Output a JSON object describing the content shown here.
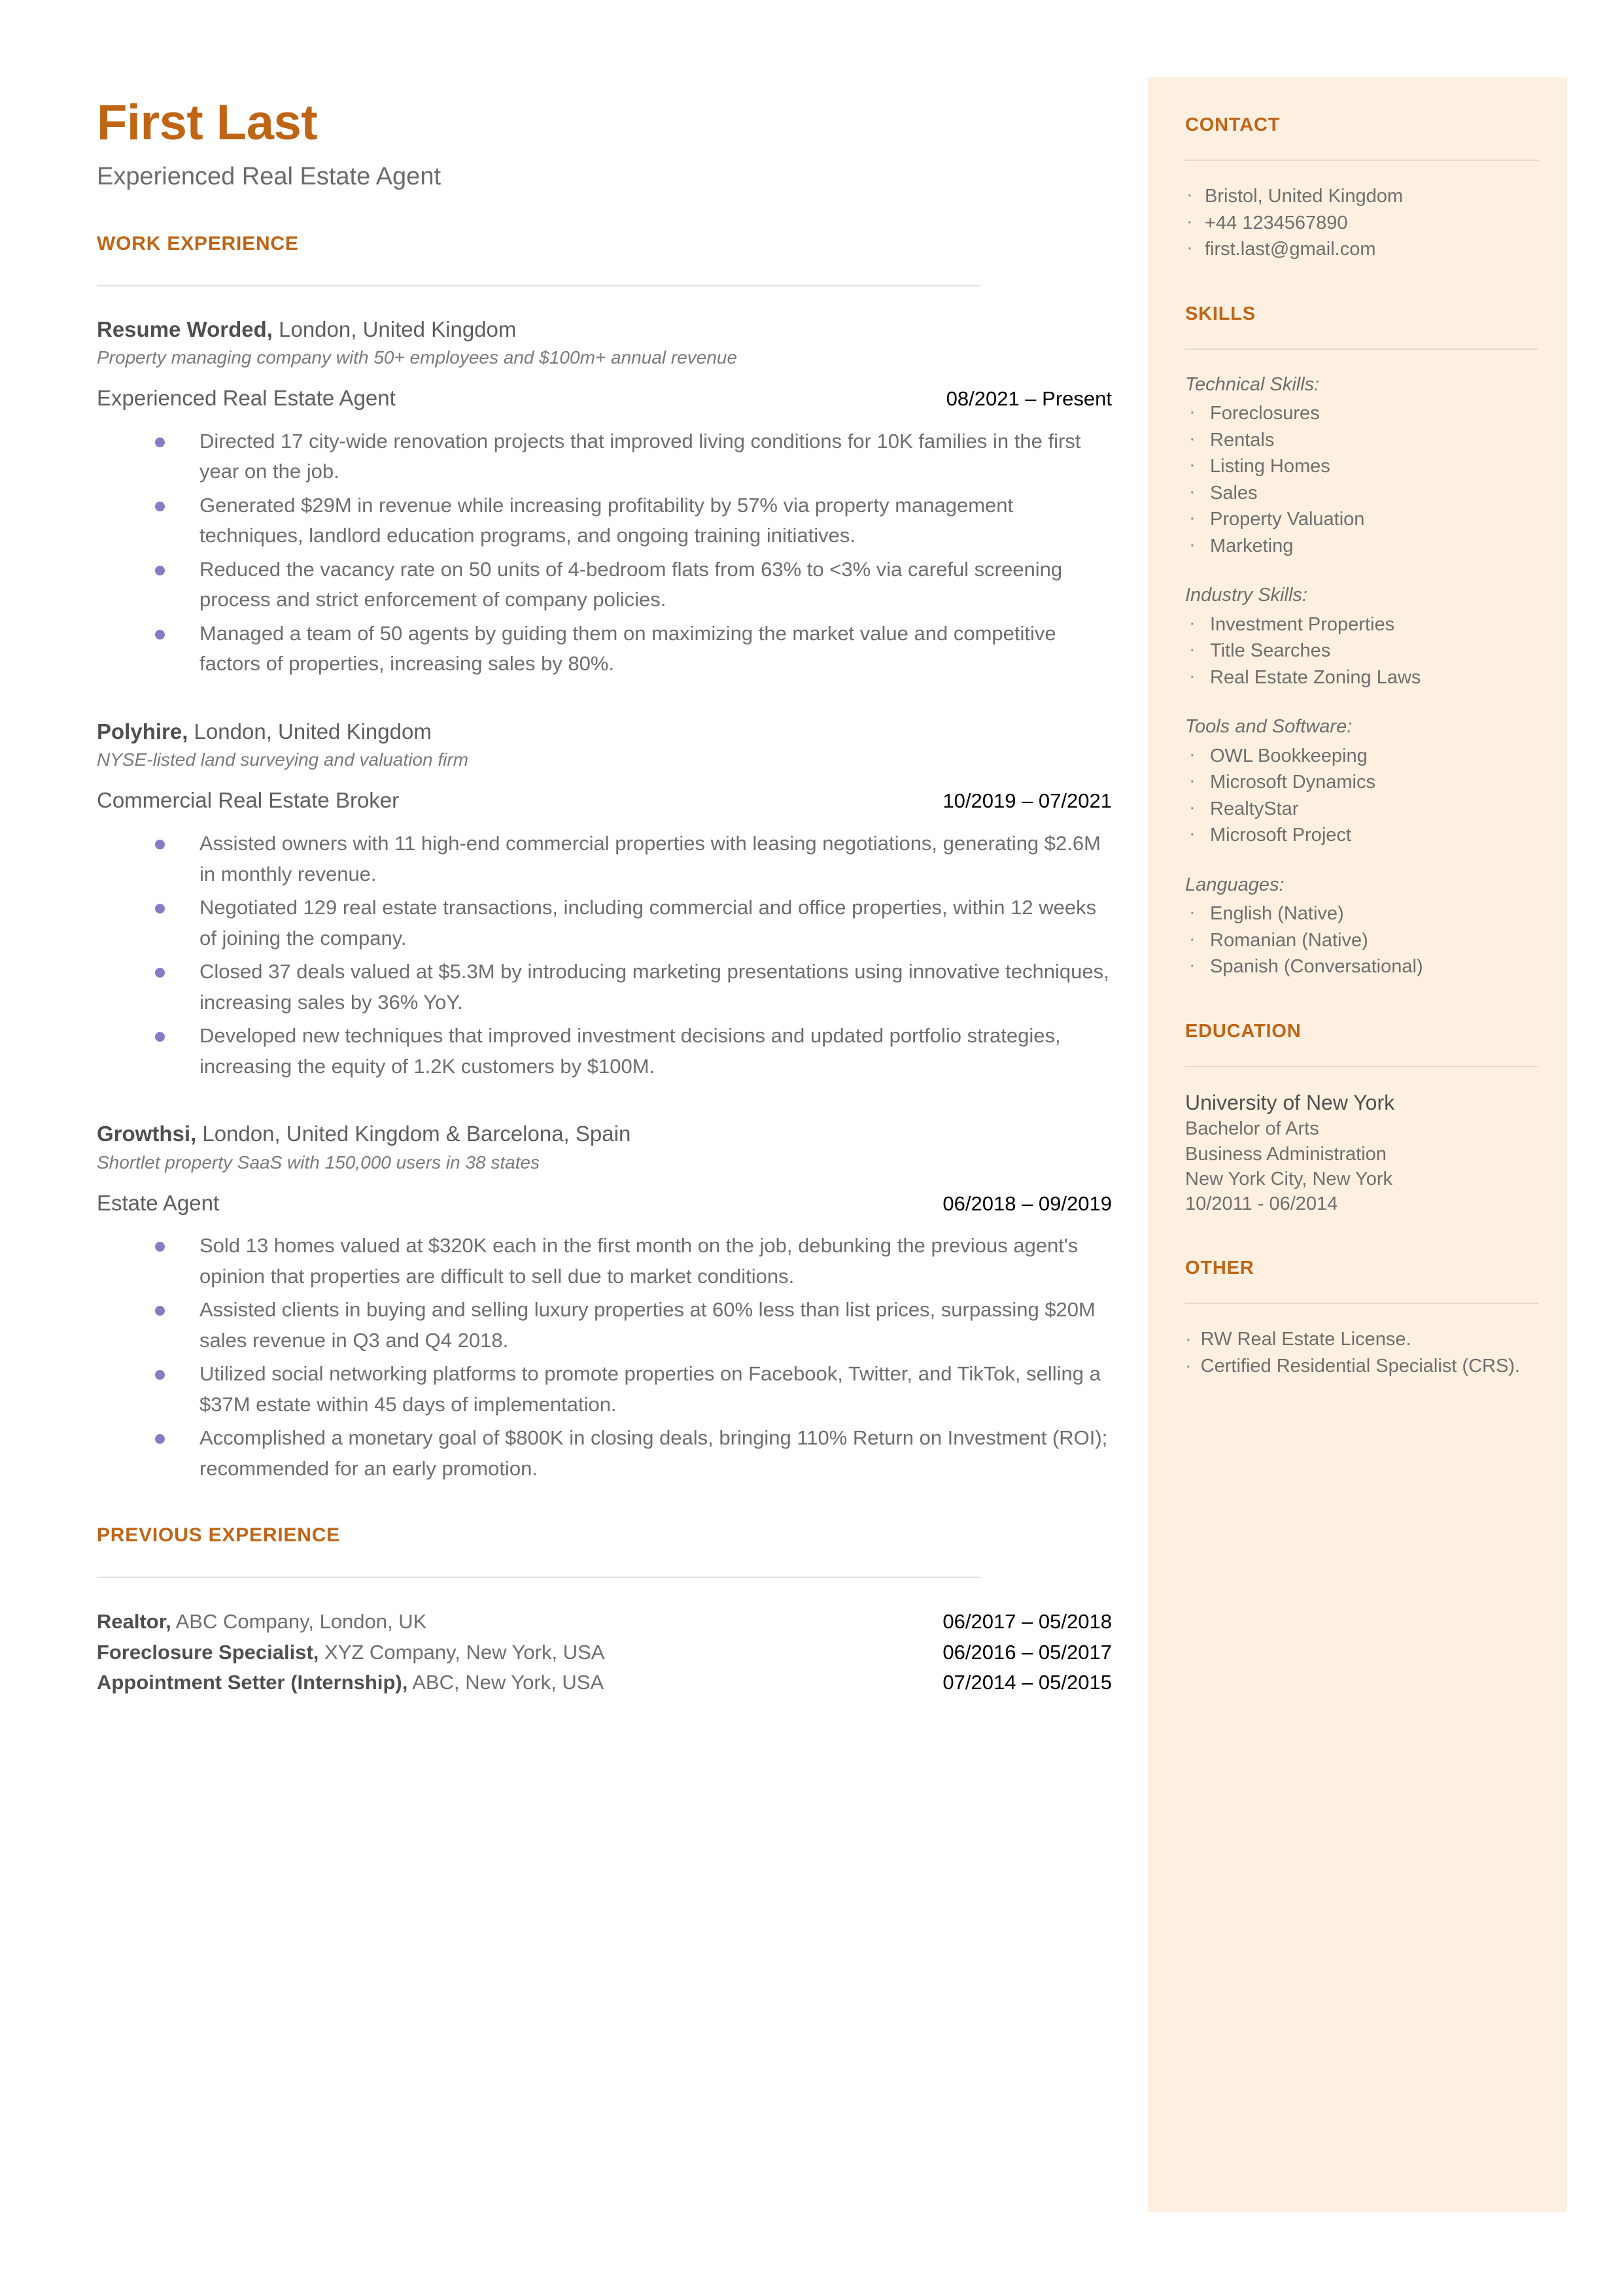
{
  "header": {
    "name": "First Last",
    "headline": "Experienced Real Estate Agent"
  },
  "colors": {
    "accent": "#BF6516",
    "sidebar_background": "#FDF0E1",
    "bullet": "#8B79C4",
    "body_text": "#6e6e6e",
    "date_text": "#000000"
  },
  "main": {
    "work_experience_heading": "WORK EXPERIENCE",
    "previous_experience_heading": "PREVIOUS EXPERIENCE",
    "jobs": [
      {
        "company": "Resume Worded,",
        "location": " London, United Kingdom",
        "description": "Property managing company with 50+ employees and $100m+ annual revenue",
        "title": "Experienced Real Estate Agent",
        "dates": "08/2021 – Present",
        "bullets": [
          "Directed 17 city-wide renovation projects that improved living conditions for 10K families in the first year on the job.",
          "Generated $29M in revenue while increasing profitability by 57% via property management techniques, landlord education programs, and ongoing training initiatives.",
          "Reduced the vacancy rate on 50 units of 4-bedroom flats from 63% to <3% via careful screening process and strict enforcement of company policies.",
          "Managed a team of 50 agents by guiding them on maximizing the market value and competitive factors of properties, increasing sales by 80%."
        ]
      },
      {
        "company": "Polyhire,",
        "location": " London, United Kingdom",
        "description": "NYSE-listed land surveying and valuation firm",
        "title": "Commercial Real Estate Broker",
        "dates": "10/2019 – 07/2021",
        "bullets": [
          "Assisted owners with 11 high-end commercial properties with leasing negotiations, generating $2.6M in monthly revenue.",
          "Negotiated 129 real estate transactions, including commercial and office properties, within 12 weeks of joining the company.",
          "Closed 37 deals valued at $5.3M by introducing marketing presentations using innovative techniques, increasing sales by 36% YoY.",
          "Developed new techniques that improved investment decisions and updated portfolio strategies, increasing the equity of 1.2K customers by $100M."
        ]
      },
      {
        "company": "Growthsi,",
        "location": " London, United Kingdom & Barcelona, Spain",
        "description": "Shortlet property SaaS with 150,000 users in 38 states",
        "title": "Estate Agent",
        "dates": "06/2018 – 09/2019",
        "bullets": [
          "Sold 13 homes valued at $320K each in the first month on the job, debunking the previous agent's opinion that properties are difficult to sell due to market conditions.",
          "Assisted clients in buying and selling luxury properties at 60% less than list prices, surpassing $20M sales revenue in Q3 and Q4 2018.",
          "Utilized social networking platforms to promote properties on Facebook, Twitter, and TikTok, selling a $37M estate within 45 days of implementation.",
          "Accomplished a monetary goal of $800K in closing deals, bringing 110% Return on Investment (ROI); recommended for an early promotion."
        ]
      }
    ],
    "previous_experience": [
      {
        "role": "Realtor,",
        "detail": " ABC Company, London, UK",
        "dates": "06/2017 – 05/2018"
      },
      {
        "role": "Foreclosure Specialist,",
        "detail": " XYZ Company, New York, USA",
        "dates": "06/2016 – 05/2017"
      },
      {
        "role": "Appointment Setter (Internship),",
        "detail": " ABC, New York, USA",
        "dates": "07/2014 – 05/2015"
      }
    ]
  },
  "sidebar": {
    "contact_heading": "CONTACT",
    "contact_items": [
      "Bristol, United Kingdom",
      "+44 1234567890",
      "first.last@gmail.com"
    ],
    "skills_heading": "SKILLS",
    "skill_groups": [
      {
        "title": "Technical Skills:",
        "items": [
          "Foreclosures",
          "Rentals",
          "Listing Homes",
          "Sales",
          "Property Valuation",
          "Marketing"
        ]
      },
      {
        "title": "Industry Skills:",
        "items": [
          "Investment Properties",
          "Title Searches",
          "Real Estate Zoning Laws"
        ]
      },
      {
        "title": "Tools and Software:",
        "items": [
          "OWL Bookkeeping",
          "Microsoft Dynamics",
          "RealtyStar",
          "Microsoft Project"
        ]
      },
      {
        "title": "Languages:",
        "items": [
          "English (Native)",
          "Romanian (Native)",
          "Spanish (Conversational)"
        ]
      }
    ],
    "education_heading": "EDUCATION",
    "education": {
      "school": "University of New York",
      "degree": "Bachelor of Arts",
      "field": "Business Administration",
      "location": "New York City, New York",
      "dates": "10/2011 - 06/2014"
    },
    "other_heading": "OTHER",
    "other_items": [
      "RW Real Estate License.",
      "Certified Residential Specialist (CRS)."
    ]
  }
}
